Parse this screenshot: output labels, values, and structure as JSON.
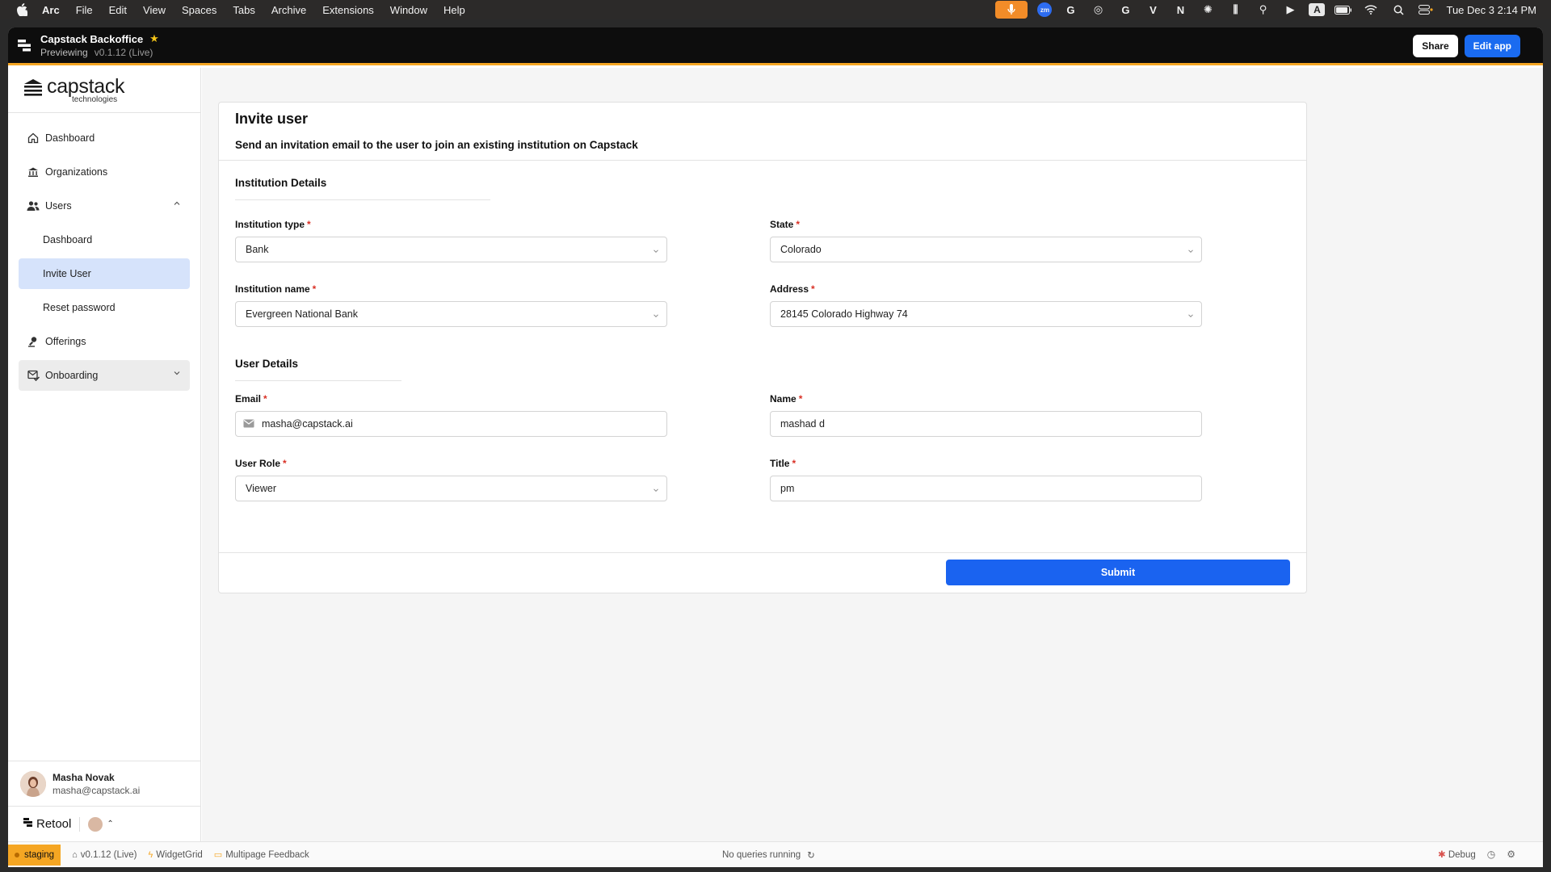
{
  "os_menubar": {
    "app": "Arc",
    "items": [
      "File",
      "Edit",
      "View",
      "Spaces",
      "Tabs",
      "Archive",
      "Extensions",
      "Window",
      "Help"
    ],
    "clock": "Tue Dec 3  2:14 PM"
  },
  "header": {
    "title": "Capstack Backoffice",
    "subtitle": "Previewing",
    "version": "v0.1.12 (Live)",
    "share_label": "Share",
    "edit_label": "Edit app"
  },
  "brand": {
    "name": "capstack",
    "sub": "technologies"
  },
  "sidebar": {
    "items": [
      {
        "label": "Dashboard"
      },
      {
        "label": "Organizations"
      },
      {
        "label": "Users"
      },
      {
        "label": "Dashboard"
      },
      {
        "label": "Invite User"
      },
      {
        "label": "Reset password"
      },
      {
        "label": "Offerings"
      },
      {
        "label": "Onboarding"
      }
    ],
    "user": {
      "name": "Masha Novak",
      "email": "masha@capstack.ai"
    },
    "retool": "Retool"
  },
  "form": {
    "title": "Invite user",
    "description": "Send an invitation email to the user to join an existing institution on Capstack",
    "institution_section": "Institution Details",
    "user_section": "User Details",
    "institution_type": {
      "label": "Institution type",
      "value": "Bank"
    },
    "state": {
      "label": "State",
      "value": "Colorado"
    },
    "institution_name": {
      "label": "Institution name",
      "value": "Evergreen National Bank"
    },
    "address": {
      "label": "Address",
      "value": "28145 Colorado Highway 74"
    },
    "email": {
      "label": "Email",
      "value": "masha@capstack.ai"
    },
    "name": {
      "label": "Name",
      "value": "mashad d"
    },
    "user_role": {
      "label": "User Role",
      "value": "Viewer"
    },
    "title_field": {
      "label": "Title",
      "value": "pm"
    },
    "required_mark": "*",
    "submit_label": "Submit"
  },
  "statusbar": {
    "env": "staging",
    "version": "v0.1.12 (Live)",
    "widget": "WidgetGrid",
    "feedback": "Multipage Feedback",
    "queries": "No queries running",
    "debug": "Debug"
  },
  "colors": {
    "accent": "#1a63f0",
    "header_bg": "#0d0d0d",
    "header_border": "#f5a623",
    "active_nav": "#d6e3fb"
  }
}
